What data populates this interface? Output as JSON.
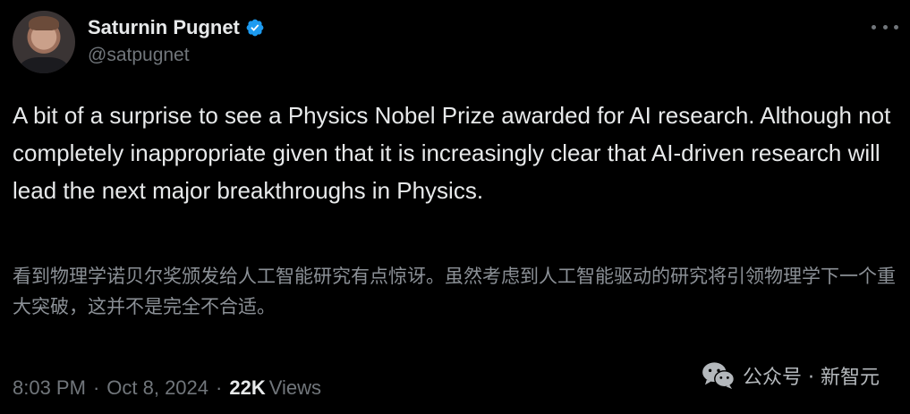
{
  "author": {
    "display_name": "Saturnin Pugnet",
    "handle": "@satpugnet",
    "verified": true
  },
  "tweet": {
    "text": "A bit of a surprise to see a Physics Nobel Prize awarded for AI research. Although not completely inappropriate given that it is increasingly clear that AI-driven research will lead the next major breakthroughs in Physics.",
    "translation": "看到物理学诺贝尔奖颁发给人工智能研究有点惊讶。虽然考虑到人工智能驱动的研究将引领物理学下一个重大突破，这并不是完全不合适。",
    "time": "8:03 PM",
    "date": "Oct 8, 2024",
    "separator": "·",
    "views_count": "22K",
    "views_label": "Views"
  },
  "watermark": {
    "text": "公众号 · 新智元",
    "icon": "wechat-icon"
  },
  "colors": {
    "background": "#000000",
    "primary_text": "#e7e9ea",
    "secondary_text": "#71767b",
    "verified_blue": "#1d9bf0"
  }
}
